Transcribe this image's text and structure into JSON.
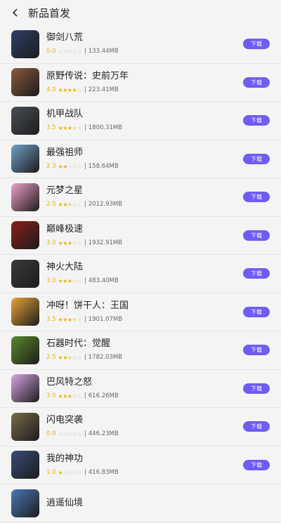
{
  "header": {
    "title": "新品首发"
  },
  "colors": {
    "accent": "#6f5cf2",
    "star": "#f0b400"
  },
  "apps": [
    {
      "name": "御剑八荒",
      "rating": "0.0",
      "stars": 0,
      "size": "133.44MB",
      "button": "下载",
      "icon": "sword-game-icon",
      "icon_bg": "#2f3f6a"
    },
    {
      "name": "原野传说：史前万年",
      "rating": "4.0",
      "stars": 4,
      "size": "223.41MB",
      "button": "下载",
      "icon": "crosshair-game-icon",
      "icon_bg": "#8a5a3c"
    },
    {
      "name": "机甲战队",
      "rating": "3.5",
      "stars": 3.5,
      "size": "1800.31MB",
      "button": "下载",
      "icon": "mech-game-icon",
      "icon_bg": "#4a4f57"
    },
    {
      "name": "最强祖师",
      "rating": "2.3",
      "stars": 2,
      "size": "158.64MB",
      "button": "下载",
      "icon": "hero-game-icon",
      "icon_bg": "#6fa0c9"
    },
    {
      "name": "元梦之星",
      "rating": "2.5",
      "stars": 2.5,
      "size": "2012.93MB",
      "button": "下载",
      "icon": "cute-star-game-icon",
      "icon_bg": "#f0a0c8"
    },
    {
      "name": "巅峰极速",
      "rating": "3.0",
      "stars": 3,
      "size": "1932.91MB",
      "button": "下载",
      "icon": "racing-car-game-icon",
      "icon_bg": "#8a1f1a"
    },
    {
      "name": "神火大陆",
      "rating": "3.0",
      "stars": 3,
      "size": "483.40MB",
      "button": "下载",
      "icon": "warrior-game-icon",
      "icon_bg": "#3a3a3a"
    },
    {
      "name": "冲呀！饼干人：王国",
      "rating": "3.5",
      "stars": 3.5,
      "size": "1901.07MB",
      "button": "下载",
      "icon": "cookie-game-icon",
      "icon_bg": "#e9a43a"
    },
    {
      "name": "石器时代：觉醒",
      "rating": "2.5",
      "stars": 2.5,
      "size": "1782.03MB",
      "button": "下载",
      "icon": "stone-age-game-icon",
      "icon_bg": "#5a8a2a"
    },
    {
      "name": "巴风特之怒",
      "rating": "3.0",
      "stars": 3,
      "size": "616.26MB",
      "button": "下载",
      "icon": "pink-pig-game-icon",
      "icon_bg": "#d9a6e6"
    },
    {
      "name": "闪电突袭",
      "rating": "0.0",
      "stars": 0,
      "size": "446.23MB",
      "button": "下载",
      "icon": "tank-game-icon",
      "icon_bg": "#7a6a4a"
    },
    {
      "name": "我的神功",
      "rating": "1.0",
      "stars": 1,
      "size": "416.83MB",
      "button": "下载",
      "icon": "cards-game-icon",
      "icon_bg": "#3a4a7a"
    },
    {
      "name": "逍遥仙境",
      "rating": "",
      "stars": 0,
      "size": "",
      "button": "",
      "icon": "partial-game-icon",
      "icon_bg": "#4a78b8"
    }
  ]
}
